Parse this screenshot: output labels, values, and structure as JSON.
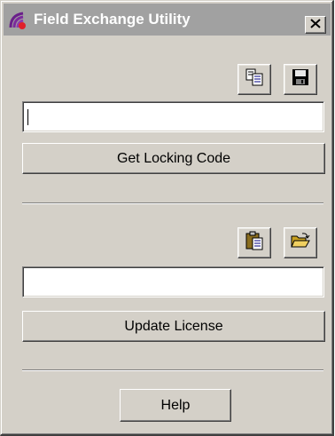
{
  "window": {
    "title": "Field Exchange Utility",
    "titlebar_color": "#a1a1a1",
    "close_label": "×",
    "app_icon": "field-exchange-app-icon"
  },
  "locking_section": {
    "copy_icon": "copy-icon",
    "save_icon": "save-floppy-icon",
    "code_value": "",
    "get_button_label": "Get Locking Code"
  },
  "license_section": {
    "paste_icon": "paste-icon",
    "open_icon": "open-folder-icon",
    "license_value": "",
    "update_button_label": "Update License"
  },
  "footer": {
    "help_label": "Help"
  }
}
